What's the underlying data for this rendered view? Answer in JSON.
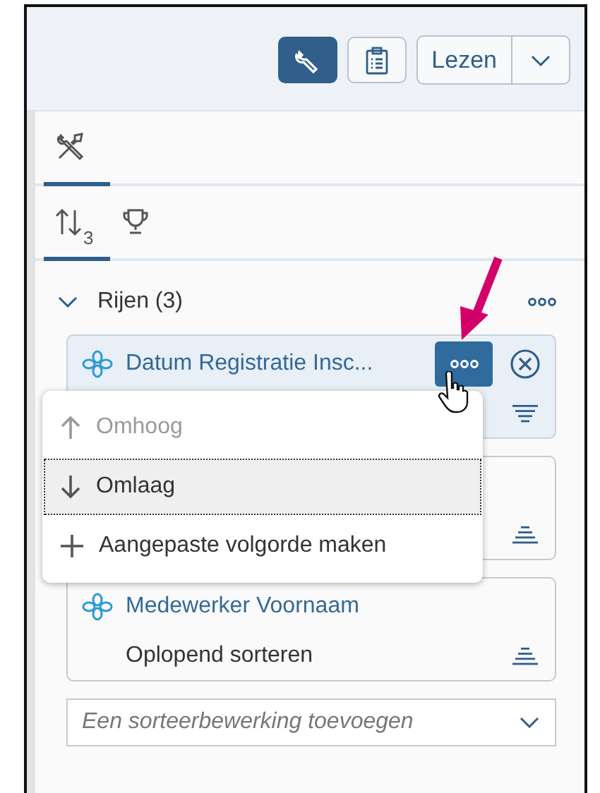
{
  "toolbar": [
    {
      "kind": "wrench",
      "selected": true
    },
    {
      "kind": "clipboard",
      "selected": false
    }
  ],
  "read_button": {
    "label": "Lezen"
  },
  "tab_rows": [
    [
      {
        "kind": "tools",
        "selected": true
      }
    ],
    [
      {
        "kind": "sort",
        "badge": "3",
        "selected": true
      },
      {
        "kind": "trophy",
        "selected": false
      }
    ]
  ],
  "section": {
    "title": "Rijen (3)",
    "expanded": true
  },
  "cards": [
    {
      "title": "Datum Registratie Insc...",
      "kind": "descending",
      "selected": true
    },
    {
      "kind": "ascending",
      "selected": false
    },
    {
      "title": "Medewerker Voornaam",
      "subtitle": "Oplopend sorteren",
      "kind": "ascending",
      "selected": false
    }
  ],
  "menu": [
    {
      "kind": "up",
      "label": "Omhoog",
      "disabled": true,
      "selected": false
    },
    {
      "kind": "down",
      "label": "Omlaag",
      "disabled": false,
      "selected": true
    },
    {
      "kind": "add",
      "label": "Aangepaste volgorde maken",
      "disabled": false,
      "selected": false
    }
  ],
  "add_sort": {
    "placeholder": "Een sorteerbewerking toevoegen"
  }
}
